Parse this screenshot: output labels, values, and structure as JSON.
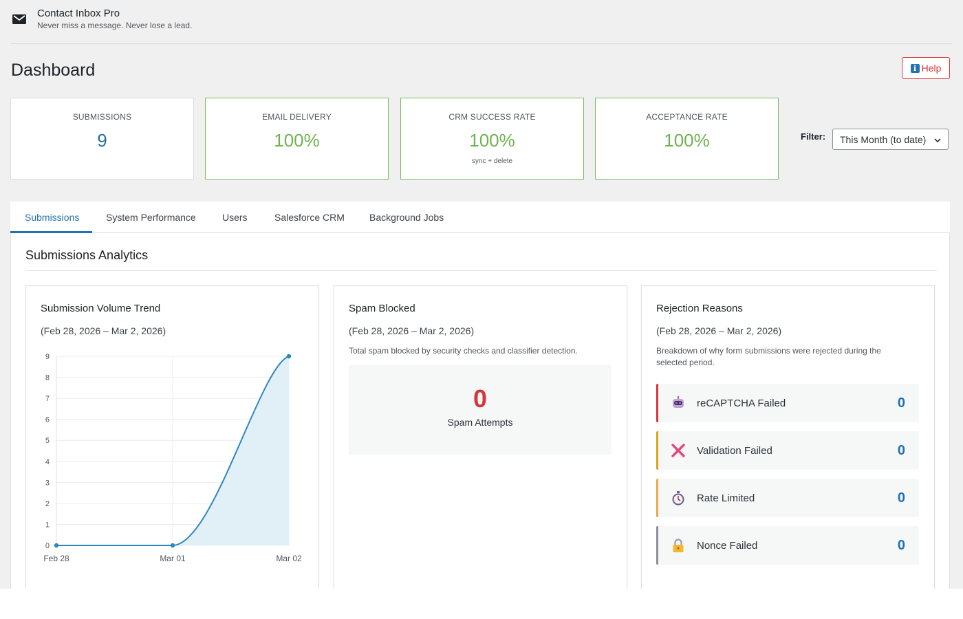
{
  "app": {
    "title": "Contact Inbox Pro",
    "tagline": "Never miss a message. Never lose a lead.",
    "icon": "envelope-icon"
  },
  "page": {
    "title": "Dashboard",
    "help_label": "Help"
  },
  "stats": [
    {
      "label": "SUBMISSIONS",
      "value": "9",
      "note": "",
      "color": "#21759b"
    },
    {
      "label": "EMAIL DELIVERY",
      "value": "100%",
      "note": "",
      "color": "#6fb252"
    },
    {
      "label": "CRM SUCCESS RATE",
      "value": "100%",
      "note": "sync + delete",
      "color": "#6fb252"
    },
    {
      "label": "ACCEPTANCE RATE",
      "value": "100%",
      "note": "",
      "color": "#6fb252"
    }
  ],
  "filter": {
    "label": "Filter:",
    "selected": "This Month (to date)"
  },
  "tabs": [
    {
      "label": "Submissions",
      "active": true
    },
    {
      "label": "System Performance",
      "active": false
    },
    {
      "label": "Users",
      "active": false
    },
    {
      "label": "Salesforce CRM",
      "active": false
    },
    {
      "label": "Background Jobs",
      "active": false
    }
  ],
  "section": {
    "title": "Submissions Analytics"
  },
  "volume_card": {
    "title": "Submission Volume Trend",
    "range": "(Feb 28, 2026 – Mar 2, 2026)"
  },
  "chart_data": {
    "type": "area",
    "categories": [
      "Feb 28",
      "Mar 01",
      "Mar 02"
    ],
    "series": [
      {
        "values": [
          0,
          0,
          9
        ]
      }
    ],
    "ylim": [
      0,
      9
    ],
    "yticks": [
      "0",
      "1",
      "2",
      "3",
      "4",
      "5",
      "6",
      "7",
      "8",
      "9"
    ],
    "grid": true,
    "color": "#2e86c1",
    "fill": "#e1eff7"
  },
  "spam_card": {
    "title": "Spam Blocked",
    "range": "(Feb 28, 2026 – Mar 2, 2026)",
    "description": "Total spam blocked by security checks and classifier detection.",
    "count": "0",
    "count_label": "Spam Attempts"
  },
  "rejection_card": {
    "title": "Rejection Reasons",
    "range": "(Feb 28, 2026 – Mar 2, 2026)",
    "description": "Breakdown of why form submissions were rejected during the selected period.",
    "reasons": [
      {
        "label": "reCAPTCHA Failed",
        "count": "0",
        "icon": "robot-icon",
        "accent": "#d63638"
      },
      {
        "label": "Validation Failed",
        "count": "0",
        "icon": "cross-mark-icon",
        "accent": "#dba617"
      },
      {
        "label": "Rate Limited",
        "count": "0",
        "icon": "stopwatch-icon",
        "accent": "#f0a44b"
      },
      {
        "label": "Nonce Failed",
        "count": "0",
        "icon": "lock-icon",
        "accent": "#8c8f94"
      }
    ]
  }
}
